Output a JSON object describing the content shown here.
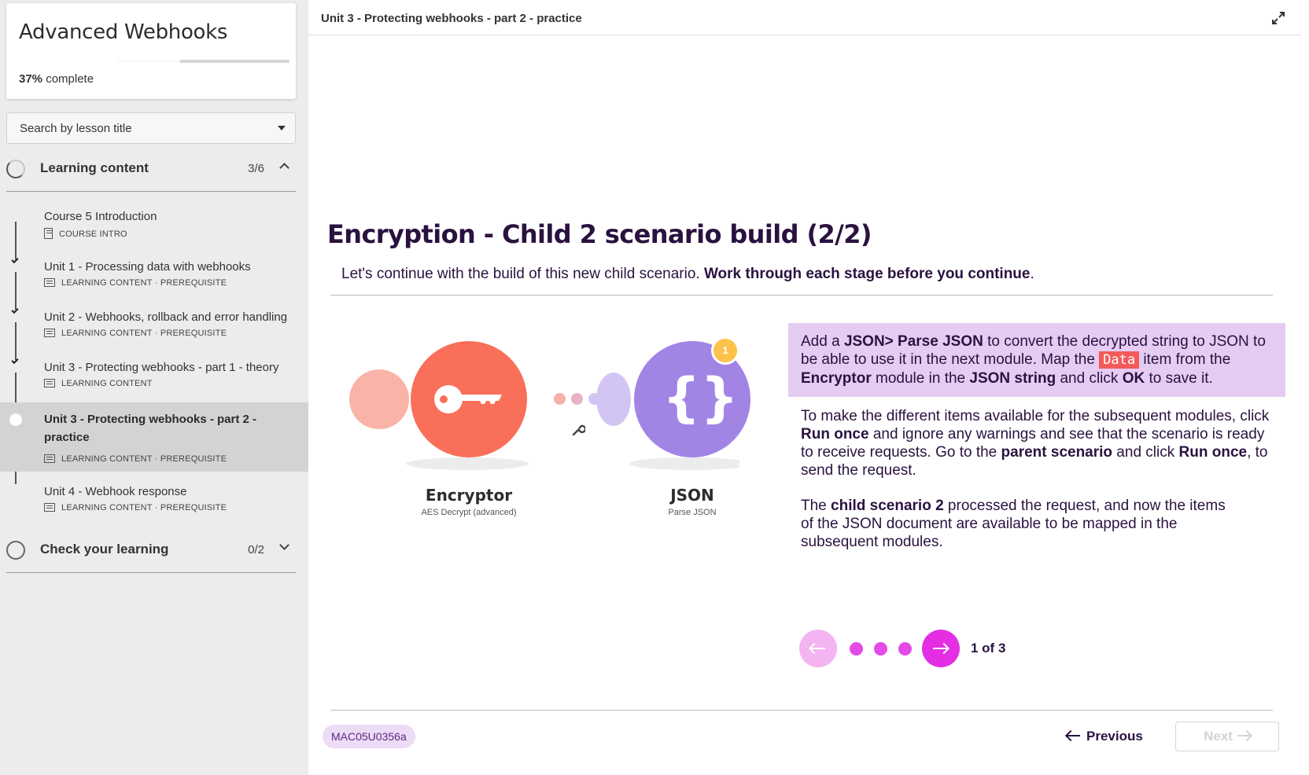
{
  "course": {
    "title": "Advanced Webhooks",
    "percent": "37%",
    "complete_label": "complete",
    "progress_fraction": 0.37
  },
  "search": {
    "placeholder": "Search by lesson title"
  },
  "sections": [
    {
      "label": "Learning content",
      "count": "3/6"
    },
    {
      "label": "Check your learning",
      "count": "0/2"
    }
  ],
  "lessons": [
    {
      "title": "Course 5 Introduction",
      "meta": "COURSE INTRO",
      "done": false
    },
    {
      "title": "Unit 1 - Processing data with webhooks",
      "meta": "LEARNING CONTENT · PREREQUISITE",
      "done": true
    },
    {
      "title": "Unit 2 - Webhooks, rollback and error handling",
      "meta": "LEARNING CONTENT · PREREQUISITE",
      "done": true
    },
    {
      "title": "Unit 3 - Protecting webhooks - part 1 - theory",
      "meta": "LEARNING CONTENT",
      "done": true
    },
    {
      "title": "Unit 3 - Protecting webhooks - part 2 - practice",
      "meta": "LEARNING CONTENT · PREREQUISITE",
      "done": false,
      "active": true
    },
    {
      "title": "Unit 4 - Webhook response",
      "meta": "LEARNING CONTENT · PREREQUISITE",
      "done": false
    }
  ],
  "breadcrumb": "Unit 3 - Protecting webhooks - part 2 - practice",
  "lesson": {
    "title": "Encryption - Child 2 scenario build (2/2)",
    "intro_plain": "Let's continue with the build of this new child scenario. ",
    "intro_bold": "Work through each stage before you continue",
    "intro_end": "."
  },
  "diagram": {
    "module1": {
      "name": "Encryptor",
      "sub": "AES Decrypt (advanced)",
      "color": "#f96f59"
    },
    "module2": {
      "name": "JSON",
      "sub": "Parse JSON",
      "color": "#a284e5",
      "badge": "1"
    }
  },
  "callout": {
    "p1": "Add a ",
    "b1": "JSON> Parse JSON",
    "p2": " to convert the decrypted string to JSON to be able to use it in the next module. Map the ",
    "code": "Data",
    "p3": " item from the ",
    "b2": "Encryptor",
    "p4": " module in the ",
    "b3": "JSON string",
    "p5": " and click ",
    "b4": "OK",
    "p6": " to save it."
  },
  "body": {
    "para1": {
      "p1": "To make the different items available for the subsequent modules, click ",
      "b1": "Run once",
      "p2": " and ignore any warnings and see that the scenario is ready to receive requests. Go to the ",
      "b2": "parent scenario",
      "p3": " and click ",
      "b3": "Run once",
      "p4": ", to send the request."
    },
    "para2": {
      "p1": "The ",
      "b1": "child scenario 2",
      "p2": " processed the request, and now the items of the JSON document are available to be mapped in the subsequent modules."
    }
  },
  "carousel": {
    "page_label": "1 of 3",
    "current": 1,
    "total": 3
  },
  "footer": {
    "code": "MAC05U0356a",
    "previous": "Previous",
    "next": "Next"
  },
  "colors": {
    "accent": "#e32ee4",
    "accent_light": "#f3b4f1",
    "heading": "#2a1240",
    "callout_bg": "#e4ccf2"
  }
}
